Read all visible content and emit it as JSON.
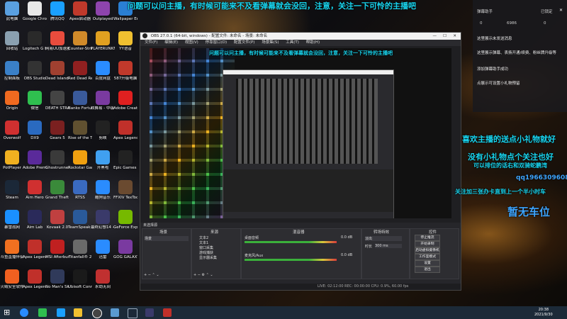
{
  "desktop_icons": [
    {
      "label": "此电脑",
      "color": "#5aa0e0"
    },
    {
      "label": "Google Chrome",
      "color": "#e8e8e8"
    },
    {
      "label": "腾讯QQ",
      "color": "#1aa0ff"
    },
    {
      "label": "Apex启动器",
      "color": "#c0392b"
    },
    {
      "label": "Outplayed",
      "color": "#8e44ad"
    },
    {
      "label": "Wallpaper Engine",
      "color": "#2a7fd4"
    },
    {
      "label": "回收站",
      "color": "#8aa0b0"
    },
    {
      "label": "Logitech G HUB",
      "color": "#2a2a2a"
    },
    {
      "label": "网易UU加速器",
      "color": "#e84c3d"
    },
    {
      "label": "Counter-Strike: Global Off...",
      "color": "#d08a2a"
    },
    {
      "label": "PLAYERUNKNOWN'S BATTLEGR...",
      "color": "#e0a020"
    },
    {
      "label": "YY语音",
      "color": "#f0c030"
    },
    {
      "label": "控制面板",
      "color": "#3a80c8"
    },
    {
      "label": "OBS Studio",
      "color": "#333"
    },
    {
      "label": "Dead Island Riptide Defi...",
      "color": "#a04030"
    },
    {
      "label": "Red Dead Redempti...",
      "color": "#902020"
    },
    {
      "label": "百度网盘",
      "color": "#2a8cff"
    },
    {
      "label": "587升级电脑",
      "color": "#c0392b"
    },
    {
      "label": "Origin",
      "color": "#f06a20"
    },
    {
      "label": "微信",
      "color": "#2fbf4f"
    },
    {
      "label": "DEATH STRANDING",
      "color": "#444"
    },
    {
      "label": "Banko Fortune ...",
      "color": "#3a5a9a"
    },
    {
      "label": "炫舞易 - 中级 x",
      "color": "#7a3aa0"
    },
    {
      "label": "Adobe Creati...",
      "color": "#e02020"
    },
    {
      "label": "Overwolf",
      "color": "#d03030"
    },
    {
      "label": "DX9",
      "color": "#2a6ac0"
    },
    {
      "label": "Gears 5",
      "color": "#7a2020"
    },
    {
      "label": "Rise of the Tomb Ra...",
      "color": "#605030"
    },
    {
      "label": "剪映",
      "color": "#222"
    },
    {
      "label": "Apex Legends",
      "color": "#c0302a"
    },
    {
      "label": "PotPlayer",
      "color": "#f0b020"
    },
    {
      "label": "Adobe Premie...",
      "color": "#5a2a9a"
    },
    {
      "label": "Ghostrunner - 幽灵行者",
      "color": "#3a3a3a"
    },
    {
      "label": "Rockstar Games...",
      "color": "#f0a010"
    },
    {
      "label": "开黑啦",
      "color": "#40a0f0"
    },
    {
      "label": "Epic Games Launcher",
      "color": "#222"
    },
    {
      "label": "Steam",
      "color": "#1b2838"
    },
    {
      "label": "Aim Hero",
      "color": "#d03030"
    },
    {
      "label": "Grand Theft Auto V",
      "color": "#3a8a3a"
    },
    {
      "label": "RTSS",
      "color": "#3a6ac0"
    },
    {
      "label": "酷狗音乐",
      "color": "#2a8cff"
    },
    {
      "label": "FFXIV TexTools",
      "color": "#6a4a30"
    },
    {
      "label": "暴雪战网",
      "color": "#1a90ff"
    },
    {
      "label": "Aim Lab",
      "color": "#2a2a5a"
    },
    {
      "label": "Kovaak 2.0",
      "color": "#c04040"
    },
    {
      "label": "TeamSpeak 3 Client",
      "color": "#2a5a9a"
    },
    {
      "label": "最终幻想14 - 中国版",
      "color": "#3a3a6a"
    },
    {
      "label": "GeForce Experience",
      "color": "#76b900"
    },
    {
      "label": "斗鱼直播伴侣",
      "color": "#f07020"
    },
    {
      "label": "Apex Legends",
      "color": "#c0302a"
    },
    {
      "label": "MSI Afterburner",
      "color": "#c02020"
    },
    {
      "label": "Titanfall® 2",
      "color": "#6a6a6a"
    },
    {
      "label": "迅雷",
      "color": "#2a8cff"
    },
    {
      "label": "GOG GALAXY...",
      "color": "#7a3aa0"
    },
    {
      "label": "火绒安全软件",
      "color": "#f06020"
    },
    {
      "label": "Apex Legends",
      "color": "#c0302a"
    },
    {
      "label": "No Man's Sky",
      "color": "#303a5a"
    },
    {
      "label": "Ubisoft Connect",
      "color": "#1a1a1a"
    },
    {
      "label": "永劫无间",
      "color": "#c03030"
    }
  ],
  "overlay": {
    "top_scroll": "问题可以问主播，有时候可能来不及看弹幕就会没回，注意，关注一下可怜的主播吧",
    "preview_scroll": "问题可以问主播，有时候可能来不及看弹幕就会没回，注意，关注一下可怜的主播吧",
    "gift_line1": "喜欢主播的送点小礼物就好",
    "gift_line2": "没有小礼物点个关注也好",
    "ranking_line": "可以排位的话右和双骑蛇鹏湾",
    "qq_line": "qq1966309608",
    "fans_line": "关注加三张办卡直到上一个半小时车",
    "no_car": "暂无车位"
  },
  "colors": {
    "cyan": "#19d6f0",
    "blue_text": "#3fa6ff",
    "orange": "#f0a030"
  },
  "chat": {
    "title": "弹幕助手",
    "toggle_label": "已锁定",
    "counter_a": "0",
    "counter_b": "6986",
    "counter_c": "0",
    "messages": [
      "这里展示未发送消息",
      "这里展示弹幕、表扬开通/续费、粉丝牌升级等",
      "添加弹幕助手成功",
      "点展示可设置小礼物预留"
    ]
  },
  "obs": {
    "title": "OBS 27.0.1 (64-bit, windows) - 配置文件: 未命名 - 场景: 未命名",
    "menu": [
      "文件(F)",
      "编辑(E)",
      "视图(V)",
      "停靠窗口(D)",
      "配置文件(P)",
      "场景集(S)",
      "工具(T)",
      "帮助(H)"
    ],
    "panels": {
      "scenes_header": "场景",
      "scene_item": "场景",
      "sources_header": "来源",
      "sources": [
        "文本2",
        "文本1",
        "窗口采集",
        "游戏捕获",
        "显示器采集"
      ],
      "mixer_header": "混音器",
      "mixer_tracks": [
        {
          "name": "桌面音频",
          "db": "0.0 dB"
        },
        {
          "name": "麦克风/Aux",
          "db": "0.0 dB"
        }
      ],
      "transition_header": "转场特效",
      "transition_type": "淡出",
      "duration_label": "时长",
      "duration_value": "300 ms",
      "controls_header": "控件",
      "controls": [
        "停止推流",
        "开始录制",
        "启动虚拟摄像机",
        "工作室模式",
        "设置",
        "退出"
      ]
    },
    "scenes_toolbar": "未选择源",
    "status": "LIVE: 02:12:00   REC: 00:00:00   CPU: 0.9%, 60.00 fps"
  },
  "taskbar": {
    "time": "20:38",
    "date": "2021/9/30"
  }
}
